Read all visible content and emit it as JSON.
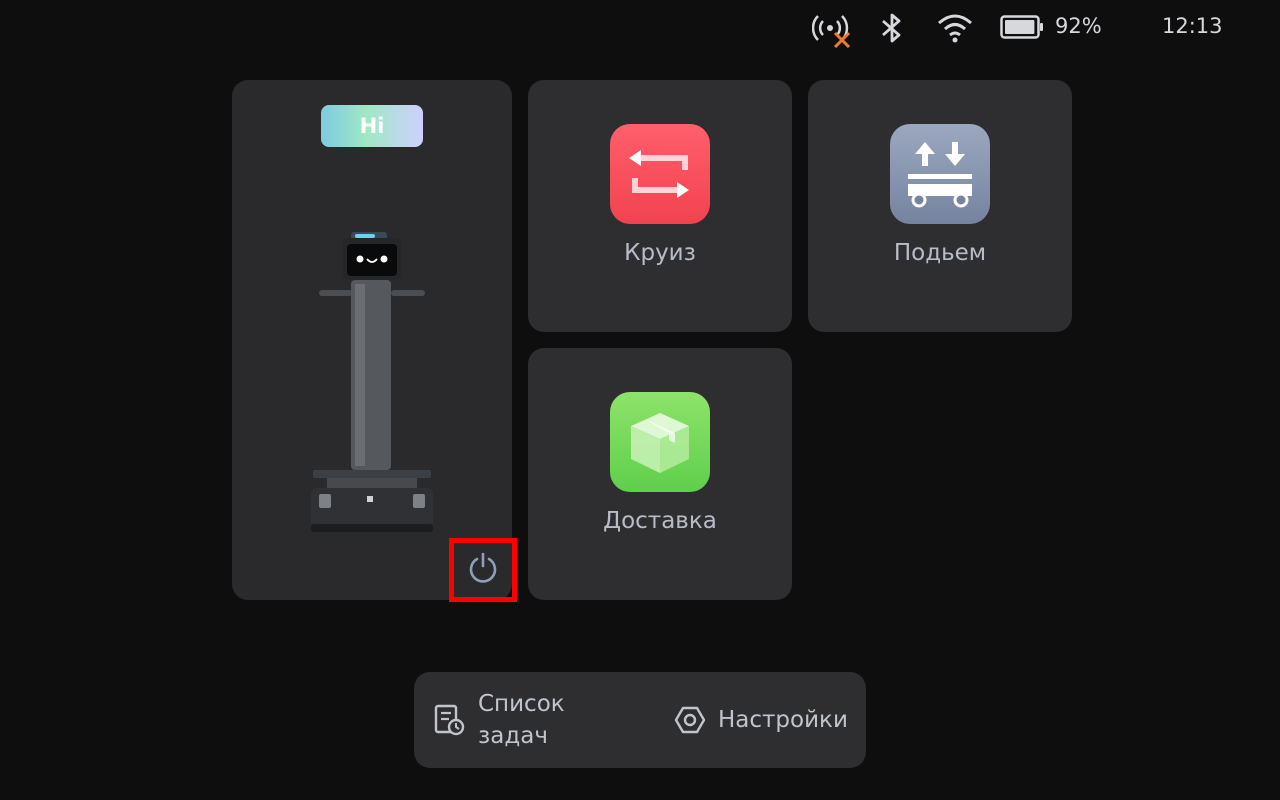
{
  "status_bar": {
    "signal_icon": "signal-disconnected-icon",
    "bluetooth_icon": "bluetooth-icon",
    "wifi_icon": "wifi-icon",
    "battery_icon": "battery-icon",
    "battery_percent": "92%",
    "battery_level": 0.92,
    "time": "12:13",
    "signal_x_color": "#f07a2a"
  },
  "robot_panel": {
    "greeting": "Hi",
    "power_icon": "power-icon"
  },
  "modes": {
    "cruise": {
      "label": "Круиз",
      "icon": "cruise-loop-icon",
      "color": "#f5495a"
    },
    "lift": {
      "label": "Подьем",
      "icon": "lift-cart-icon",
      "color": "#8391ad"
    },
    "delivery": {
      "label": "Доставка",
      "icon": "delivery-box-icon",
      "color": "#6bd653"
    }
  },
  "bottom_bar": {
    "task_list_line1": "Список",
    "task_list_line2": "задач",
    "task_list_icon": "task-list-icon",
    "settings_label": "Настройки",
    "settings_icon": "settings-hex-icon"
  }
}
